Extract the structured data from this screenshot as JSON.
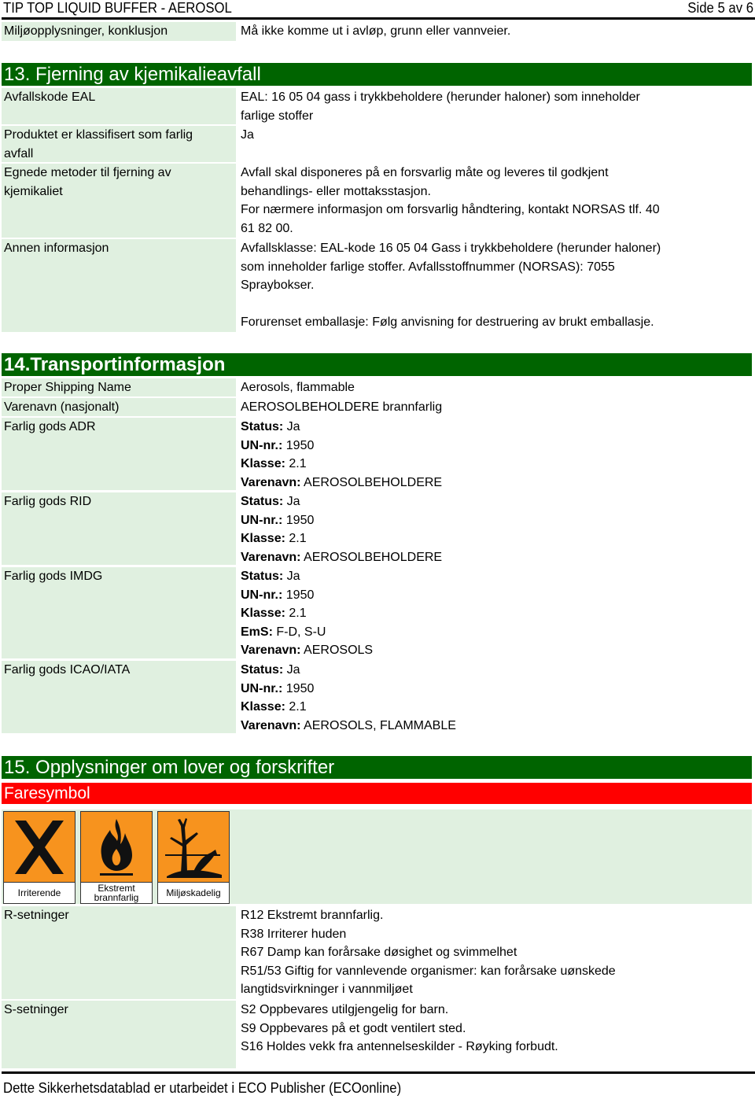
{
  "header": {
    "title": "TIP TOP LIQUID BUFFER - AEROSOL",
    "page": "Side 5 av 6"
  },
  "env_conclusion": {
    "label": "Miljøopplysninger, konklusjon",
    "value": "Må ikke komme ut i avløp, grunn eller vannveier."
  },
  "section13": {
    "title": "13. Fjerning av kjemikalieavfall",
    "rows": [
      {
        "label": [
          "Avfallskode EAL"
        ],
        "value": [
          "EAL: 16 05 04 gass i trykkbeholdere (herunder haloner) som inneholder",
          "farlige stoffer"
        ]
      },
      {
        "label": [
          "Produktet er klassifisert som farlig",
          "avfall"
        ],
        "value": [
          "Ja"
        ]
      },
      {
        "label": [
          "Egnede metoder til fjerning av",
          "kjemikaliet"
        ],
        "value": [
          "Avfall skal disponeres på en forsvarlig måte og leveres til godkjent",
          "behandlings- eller mottaksstasjon.",
          "For nærmere informasjon om forsvarlig håndtering, kontakt NORSAS tlf. 40",
          "61 82 00."
        ]
      },
      {
        "label": [
          "Annen informasjon"
        ],
        "value": [
          "Avfallsklasse: EAL-kode 16 05 04 Gass i trykkbeholdere (herunder haloner)",
          "som inneholder farlige stoffer. Avfallsstoffnummer (NORSAS): 7055",
          "Spraybokser.",
          "",
          "Forurenset emballasje: Følg anvisning for destruering av brukt emballasje."
        ]
      }
    ]
  },
  "section14": {
    "title": "14.Transportinformasjon",
    "proper_shipping_name": {
      "label": "Proper Shipping Name",
      "value": "Aerosols, flammable"
    },
    "national_name": {
      "label": "Varenavn (nasjonalt)",
      "value": "AEROSOLBEHOLDERE brannfarlig"
    },
    "modes": [
      {
        "label": "Farlig gods ADR",
        "fields": [
          {
            "k": "Status:",
            "v": " Ja"
          },
          {
            "k": "UN-nr.:",
            "v": " 1950"
          },
          {
            "k": "Klasse:",
            "v": " 2.1"
          },
          {
            "k": "Varenavn:",
            "v": " AEROSOLBEHOLDERE"
          }
        ]
      },
      {
        "label": "Farlig gods RID",
        "fields": [
          {
            "k": "Status:",
            "v": " Ja"
          },
          {
            "k": "UN-nr.:",
            "v": " 1950"
          },
          {
            "k": "Klasse:",
            "v": " 2.1"
          },
          {
            "k": "Varenavn:",
            "v": " AEROSOLBEHOLDERE"
          }
        ]
      },
      {
        "label": "Farlig gods IMDG",
        "fields": [
          {
            "k": "Status:",
            "v": " Ja"
          },
          {
            "k": "UN-nr.:",
            "v": " 1950"
          },
          {
            "k": "Klasse:",
            "v": " 2.1"
          },
          {
            "k": "EmS:",
            "v": " F-D, S-U"
          },
          {
            "k": "Varenavn:",
            "v": " AEROSOLS"
          }
        ]
      },
      {
        "label": "Farlig gods ICAO/IATA",
        "fields": [
          {
            "k": "Status:",
            "v": " Ja"
          },
          {
            "k": "UN-nr.:",
            "v": " 1950"
          },
          {
            "k": "Klasse:",
            "v": " 2.1"
          },
          {
            "k": "Varenavn:",
            "v": " AEROSOLS, FLAMMABLE"
          }
        ]
      }
    ]
  },
  "section15": {
    "title": "15. Opplysninger om lover og forskrifter",
    "hazard_heading": "Faresymbol",
    "symbols": [
      {
        "icon": "irritant-x-icon",
        "caption": [
          "Irriterende"
        ]
      },
      {
        "icon": "flame-icon",
        "caption": [
          "Ekstremt",
          "brannfarlig"
        ]
      },
      {
        "icon": "dead-tree-fish-icon",
        "caption": [
          "Miljøskadelig"
        ]
      }
    ],
    "colors": {
      "symbol_bg": "#f7931e",
      "section_bg": "#006400",
      "subhead_bg": "#ff0000",
      "label_bg": "#e0f0e0"
    },
    "r_phrases": {
      "label": "R-setninger",
      "lines": [
        "R12 Ekstremt brannfarlig.",
        "R38 Irriterer huden",
        "R67 Damp kan forårsake døsighet og svimmelhet",
        "R51/53 Giftig for vannlevende organismer: kan forårsake uønskede",
        "langtidsvirkninger i vannmiljøet"
      ]
    },
    "s_phrases": {
      "label": "S-setninger",
      "lines": [
        "S2 Oppbevares utilgjengelig for barn.",
        "S9 Oppbevares på et godt ventilert sted.",
        "S16 Holdes vekk fra antennelseskilder - Røyking forbudt."
      ]
    }
  },
  "footer": {
    "text": "Dette Sikkerhetsdatablad er utarbeidet i ECO Publisher (ECOonline)"
  }
}
